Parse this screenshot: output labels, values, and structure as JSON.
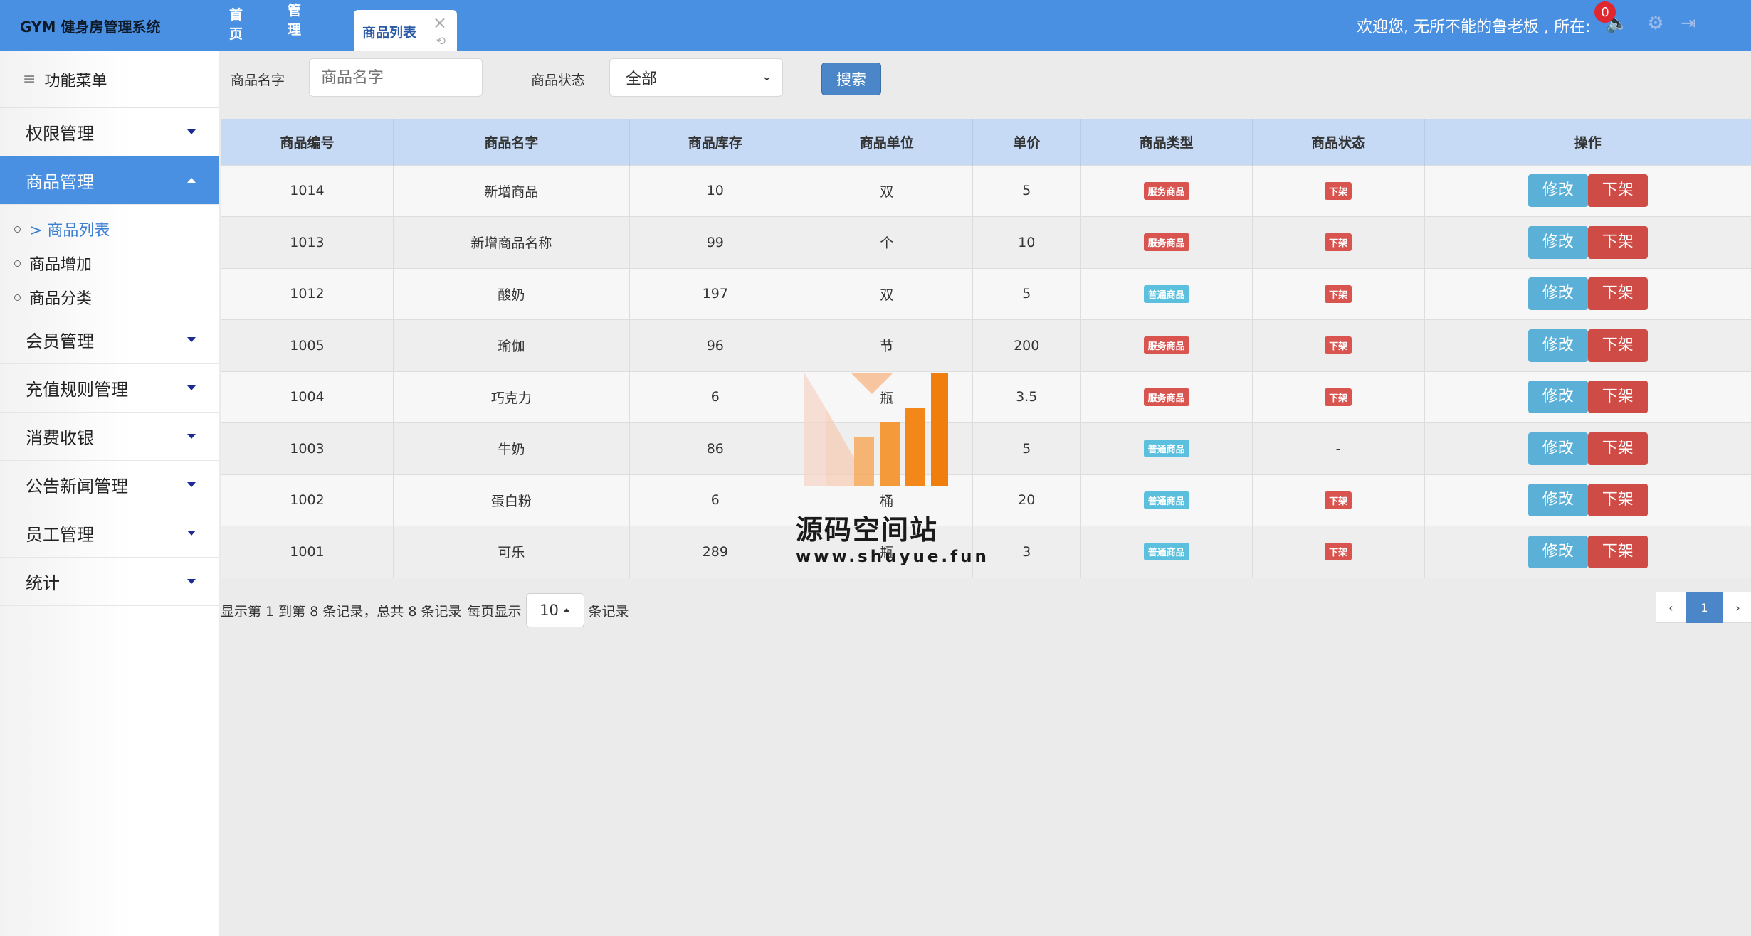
{
  "app": {
    "title": "GYM 健身房管理系统"
  },
  "tabs": {
    "home": "首页",
    "post": "职位管理",
    "active": "商品列表"
  },
  "header": {
    "welcome": "欢迎您, 无所不能的鲁老板 , 所在:",
    "notify_count": "0"
  },
  "sidebar": {
    "menu_title": "功能菜单",
    "items": [
      {
        "label": "权限管理"
      },
      {
        "label": "商品管理"
      },
      {
        "label": "会员管理"
      },
      {
        "label": "充值规则管理"
      },
      {
        "label": "消费收银"
      },
      {
        "label": "公告新闻管理"
      },
      {
        "label": "员工管理"
      },
      {
        "label": "统计"
      }
    ],
    "sub_items": [
      {
        "label": "> 商品列表"
      },
      {
        "label": "商品增加"
      },
      {
        "label": "商品分类"
      }
    ]
  },
  "search": {
    "name_label": "商品名字",
    "name_placeholder": "商品名字",
    "status_label": "商品状态",
    "status_value": "全部",
    "button": "搜索"
  },
  "table": {
    "headers": [
      "商品编号",
      "商品名字",
      "商品库存",
      "商品单位",
      "单价",
      "商品类型",
      "商品状态",
      "操作"
    ],
    "edit_label": "修改",
    "off_label": "下架",
    "rows": [
      {
        "id": "1014",
        "name": "新增商品",
        "stock": "10",
        "unit": "双",
        "price": "5",
        "type": "服务商品",
        "type_color": "red",
        "status": "下架"
      },
      {
        "id": "1013",
        "name": "新增商品名称",
        "stock": "99",
        "unit": "个",
        "price": "10",
        "type": "服务商品",
        "type_color": "red",
        "status": "下架"
      },
      {
        "id": "1012",
        "name": "酸奶",
        "stock": "197",
        "unit": "双",
        "price": "5",
        "type": "普通商品",
        "type_color": "blue",
        "status": "下架"
      },
      {
        "id": "1005",
        "name": "瑜伽",
        "stock": "96",
        "unit": "节",
        "price": "200",
        "type": "服务商品",
        "type_color": "red",
        "status": "下架"
      },
      {
        "id": "1004",
        "name": "巧克力",
        "stock": "6",
        "unit": "瓶",
        "price": "3.5",
        "type": "服务商品",
        "type_color": "red",
        "status": "下架"
      },
      {
        "id": "1003",
        "name": "牛奶",
        "stock": "86",
        "unit": "瓶",
        "price": "5",
        "type": "普通商品",
        "type_color": "blue",
        "status": "-"
      },
      {
        "id": "1002",
        "name": "蛋白粉",
        "stock": "6",
        "unit": "桶",
        "price": "20",
        "type": "普通商品",
        "type_color": "blue",
        "status": "下架"
      },
      {
        "id": "1001",
        "name": "可乐",
        "stock": "289",
        "unit": "瓶",
        "price": "3",
        "type": "普通商品",
        "type_color": "blue",
        "status": "下架"
      }
    ]
  },
  "pagination": {
    "info": "显示第 1 到第 8 条记录，总共 8 条记录",
    "per_page_label": "每页显示",
    "per_page_value": "10",
    "records_label": "条记录",
    "prev": "‹",
    "current": "1",
    "next": "›"
  },
  "watermark": {
    "title": "源码空间站",
    "url": "www.shuyue.fun"
  }
}
